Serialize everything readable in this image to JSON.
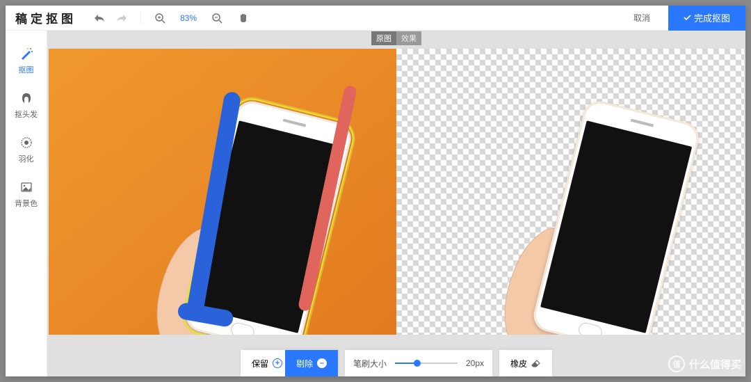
{
  "logo": "稿定抠图",
  "zoom": "83%",
  "cancel": "取消",
  "done": "完成抠图",
  "sidebar": {
    "items": [
      {
        "label": "抠图"
      },
      {
        "label": "抠头发"
      },
      {
        "label": "羽化"
      },
      {
        "label": "背景色"
      }
    ]
  },
  "viewToggle": {
    "original": "原图",
    "result": "效果"
  },
  "bottomBar": {
    "keep": "保留",
    "remove": "剔除",
    "brushSize": "笔刷大小",
    "brushValue": "20px",
    "eraser": "橡皮"
  },
  "watermark": {
    "icon": "值",
    "text": "什么值得买"
  }
}
